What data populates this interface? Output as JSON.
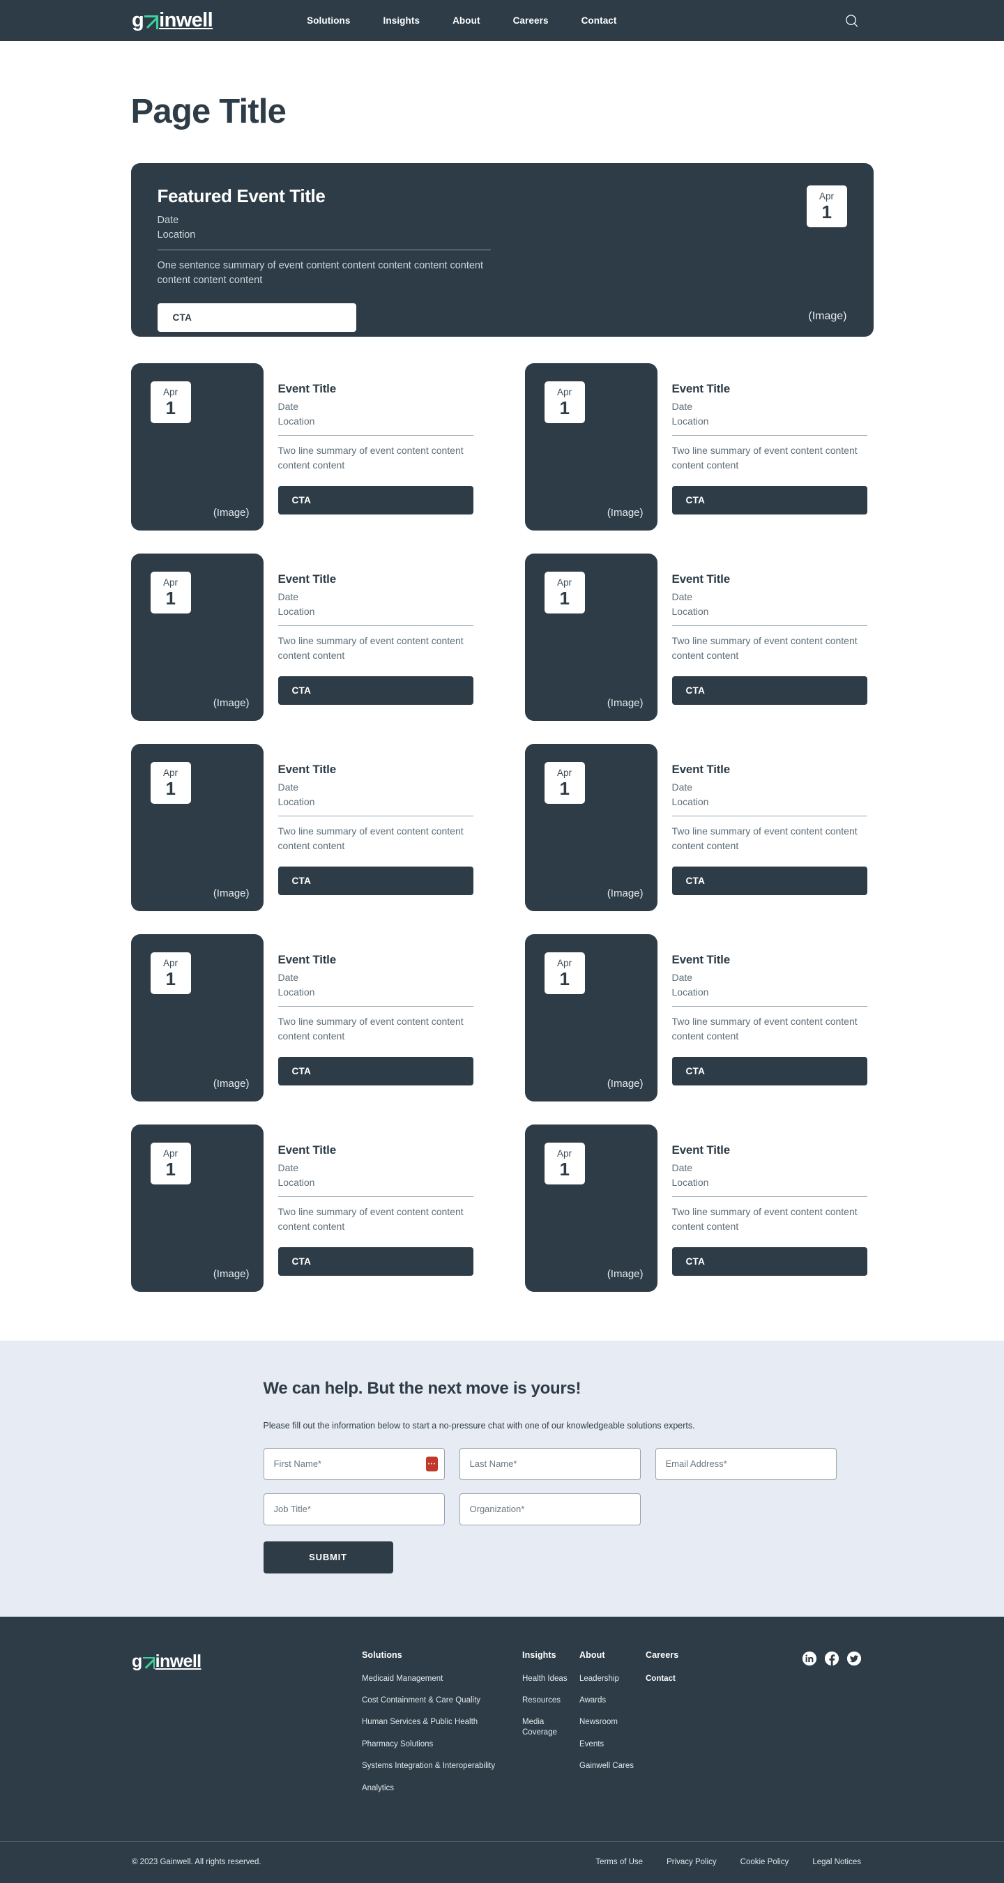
{
  "header": {
    "logo_text_before": "g",
    "logo_text_after": "inwell",
    "nav": [
      {
        "label": "Solutions"
      },
      {
        "label": "Insights"
      },
      {
        "label": "About"
      },
      {
        "label": "Careers"
      },
      {
        "label": "Contact"
      }
    ],
    "search_icon": "search-icon"
  },
  "main": {
    "page_title": "Page Title",
    "featured": {
      "title": "Featured Event Title",
      "date": "Date",
      "location": "Location",
      "summary": "One sentence summary of event content content content content  content content content content",
      "cta": "CTA",
      "image_label": "(Image)",
      "badge_month": "Apr",
      "badge_day": "1"
    },
    "events": [
      {
        "title": "Event Title",
        "date": "Date",
        "location": "Location",
        "summary": "Two line summary of event content content content content",
        "cta": "CTA",
        "image_label": "(Image)",
        "badge_month": "Apr",
        "badge_day": "1"
      },
      {
        "title": "Event Title",
        "date": "Date",
        "location": "Location",
        "summary": "Two line summary of event content content content content",
        "cta": "CTA",
        "image_label": "(Image)",
        "badge_month": "Apr",
        "badge_day": "1"
      },
      {
        "title": "Event Title",
        "date": "Date",
        "location": "Location",
        "summary": "Two line summary of event content content content content",
        "cta": "CTA",
        "image_label": "(Image)",
        "badge_month": "Apr",
        "badge_day": "1"
      },
      {
        "title": "Event Title",
        "date": "Date",
        "location": "Location",
        "summary": "Two line summary of event content content content content",
        "cta": "CTA",
        "image_label": "(Image)",
        "badge_month": "Apr",
        "badge_day": "1"
      },
      {
        "title": "Event Title",
        "date": "Date",
        "location": "Location",
        "summary": "Two line summary of event content content content content",
        "cta": "CTA",
        "image_label": "(Image)",
        "badge_month": "Apr",
        "badge_day": "1"
      },
      {
        "title": "Event Title",
        "date": "Date",
        "location": "Location",
        "summary": "Two line summary of event content content content content",
        "cta": "CTA",
        "image_label": "(Image)",
        "badge_month": "Apr",
        "badge_day": "1"
      },
      {
        "title": "Event Title",
        "date": "Date",
        "location": "Location",
        "summary": "Two line summary of event content content content content",
        "cta": "CTA",
        "image_label": "(Image)",
        "badge_month": "Apr",
        "badge_day": "1"
      },
      {
        "title": "Event Title",
        "date": "Date",
        "location": "Location",
        "summary": "Two line summary of event content content content content",
        "cta": "CTA",
        "image_label": "(Image)",
        "badge_month": "Apr",
        "badge_day": "1"
      },
      {
        "title": "Event Title",
        "date": "Date",
        "location": "Location",
        "summary": "Two line summary of event content content content content",
        "cta": "CTA",
        "image_label": "(Image)",
        "badge_month": "Apr",
        "badge_day": "1"
      },
      {
        "title": "Event Title",
        "date": "Date",
        "location": "Location",
        "summary": "Two line summary of event content content content content",
        "cta": "CTA",
        "image_label": "(Image)",
        "badge_month": "Apr",
        "badge_day": "1"
      }
    ]
  },
  "form_section": {
    "heading": "We can help. But the next move is yours!",
    "subtext": "Please fill out the information below to start a no-pressure chat with one of our knowledgeable solutions experts.",
    "fields": [
      {
        "placeholder": "First Name*",
        "value": "",
        "name": "first-name-field",
        "badge": true
      },
      {
        "placeholder": "Last Name*",
        "value": "",
        "name": "last-name-field",
        "badge": false
      },
      {
        "placeholder": "Email Address*",
        "value": "",
        "name": "email-field",
        "badge": false
      },
      {
        "placeholder": "Job Title*",
        "value": "",
        "name": "job-title-field",
        "badge": false
      },
      {
        "placeholder": "Organization*",
        "value": "",
        "name": "organization-field",
        "badge": false
      }
    ],
    "submit_label": "SUBMIT"
  },
  "footer": {
    "logo_text_before": "g",
    "logo_text_after": "inwell",
    "columns": [
      {
        "heading": "Solutions",
        "links": [
          {
            "label": "Medicaid Management",
            "bold": false
          },
          {
            "label": "Cost Containment & Care Quality",
            "bold": false
          },
          {
            "label": "Human Services & Public Health",
            "bold": false
          },
          {
            "label": "Pharmacy Solutions",
            "bold": false
          },
          {
            "label": "Systems Integration & Interoperability",
            "bold": false
          },
          {
            "label": "Analytics",
            "bold": false
          }
        ]
      },
      {
        "heading": "Insights",
        "links": [
          {
            "label": "Health Ideas",
            "bold": false
          },
          {
            "label": "Resources",
            "bold": false
          },
          {
            "label": "Media Coverage",
            "bold": false
          }
        ]
      },
      {
        "heading": "About",
        "links": [
          {
            "label": "Leadership",
            "bold": false
          },
          {
            "label": "Awards",
            "bold": false
          },
          {
            "label": "Newsroom",
            "bold": false
          },
          {
            "label": "Events",
            "bold": false
          },
          {
            "label": "Gainwell Cares",
            "bold": false
          }
        ]
      },
      {
        "heading": "Careers",
        "links": [
          {
            "label": "Contact",
            "bold": true
          }
        ]
      }
    ],
    "socials": [
      {
        "name": "linkedin-icon"
      },
      {
        "name": "facebook-icon"
      },
      {
        "name": "twitter-icon"
      }
    ],
    "copyright": "© 2023 Gainwell. All rights reserved.",
    "legal": [
      {
        "label": "Terms of Use"
      },
      {
        "label": "Privacy Policy"
      },
      {
        "label": "Cookie Policy"
      },
      {
        "label": "Legal Notices"
      }
    ]
  },
  "colors": {
    "dark": "#2d3c47",
    "accent_green": "#3cd39a",
    "form_bg": "#e7ebf3",
    "required_badge": "#c0392b"
  }
}
